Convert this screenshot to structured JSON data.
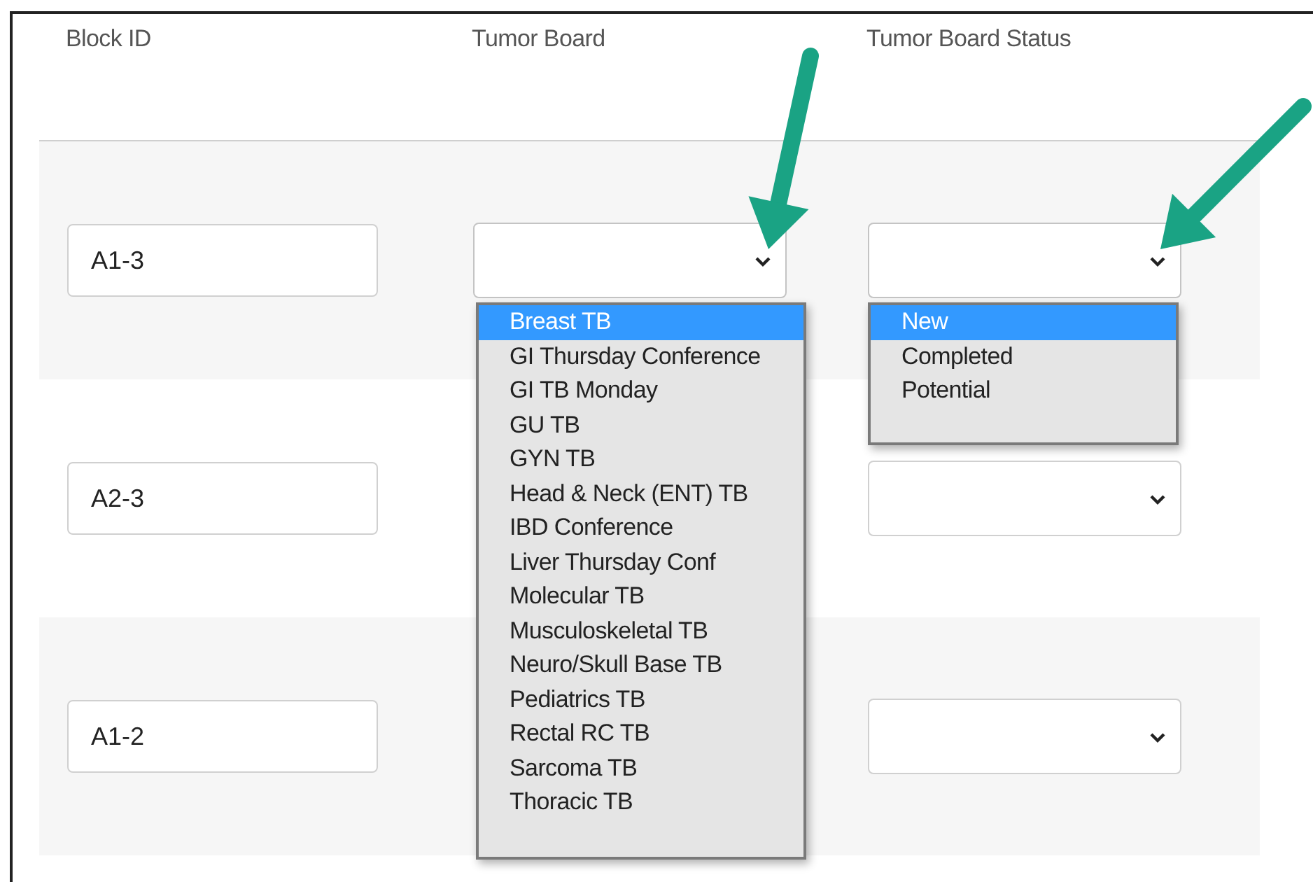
{
  "columns": [
    "Block ID",
    "Tumor Board",
    "Tumor Board Status"
  ],
  "rows": [
    {
      "block_id": "A1-3",
      "tumor_board": {
        "open": true,
        "options": [
          {
            "label": "Breast TB",
            "selected": true
          },
          {
            "label": "GI Thursday Conference",
            "selected": false
          },
          {
            "label": "GI TB Monday",
            "selected": false
          },
          {
            "label": "GU TB",
            "selected": false
          },
          {
            "label": "GYN TB",
            "selected": false
          },
          {
            "label": "Head & Neck (ENT) TB",
            "selected": false
          },
          {
            "label": "IBD Conference",
            "selected": false
          },
          {
            "label": "Liver Thursday Conf",
            "selected": false
          },
          {
            "label": "Molecular TB",
            "selected": false
          },
          {
            "label": "Musculoskeletal TB",
            "selected": false
          },
          {
            "label": "Neuro/Skull Base TB",
            "selected": false
          },
          {
            "label": "Pediatrics TB",
            "selected": false
          },
          {
            "label": "Rectal RC TB",
            "selected": false
          },
          {
            "label": "Sarcoma TB",
            "selected": false
          },
          {
            "label": "Thoracic TB",
            "selected": false
          }
        ]
      },
      "status": {
        "open": true,
        "options": [
          {
            "label": "New",
            "selected": true
          },
          {
            "label": "Completed",
            "selected": false
          },
          {
            "label": "Potential",
            "selected": false
          }
        ]
      }
    },
    {
      "block_id": "A2-3",
      "status": {
        "open": false
      }
    },
    {
      "block_id": "A1-2",
      "status": {
        "open": false
      }
    }
  ]
}
